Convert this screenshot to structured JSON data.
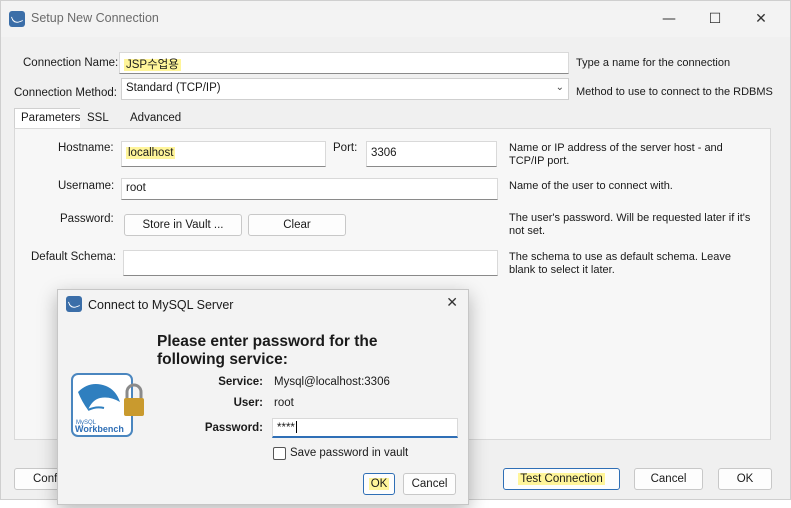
{
  "window": {
    "title": "Setup New Connection"
  },
  "form": {
    "connection_name_label": "Connection Name:",
    "connection_name_value": "JSP수업용",
    "connection_name_help": "Type a name for the connection",
    "connection_method_label": "Connection Method:",
    "connection_method_value": "Standard (TCP/IP)",
    "connection_method_help": "Method to use to connect to the RDBMS"
  },
  "tabs": [
    {
      "label": "Parameters"
    },
    {
      "label": "SSL"
    },
    {
      "label": "Advanced"
    }
  ],
  "parameters": {
    "hostname_label": "Hostname:",
    "hostname_value": "localhost",
    "port_label": "Port:",
    "port_value": "3306",
    "hostname_help": "Name or IP address of the server host - and TCP/IP port.",
    "username_label": "Username:",
    "username_value": "root",
    "username_help": "Name of the user to connect with.",
    "password_label": "Password:",
    "store_vault_label": "Store in Vault ...",
    "clear_label": "Clear",
    "password_help": "The user's password. Will be requested later if it's not set.",
    "schema_label": "Default Schema:",
    "schema_value": "",
    "schema_help": "The schema to use as default schema. Leave blank to select it later."
  },
  "footer": {
    "configure_label_partial": "Confi",
    "test_connection_label": "Test Connection",
    "cancel_label": "Cancel",
    "ok_label": "OK"
  },
  "dialog": {
    "title": "Connect to MySQL Server",
    "heading": "Please enter password for the following service:",
    "service_label": "Service:",
    "service_value": "Mysql@localhost:3306",
    "user_label": "User:",
    "user_value": "root",
    "password_label": "Password:",
    "password_value": "****",
    "save_vault_label": "Save password in vault",
    "ok_label": "OK",
    "cancel_label": "Cancel",
    "logo_text_top": "MySQL",
    "logo_text_bottom": "Workbench"
  },
  "colors": {
    "accent": "#2f6fb6",
    "highlight": "#fff59a"
  }
}
